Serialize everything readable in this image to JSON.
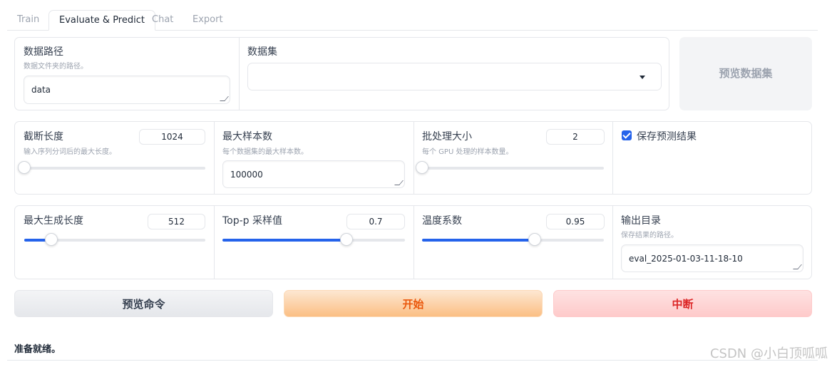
{
  "tabs": [
    {
      "label": "Train",
      "active": false
    },
    {
      "label": "Evaluate & Predict",
      "active": true
    },
    {
      "label": "Chat",
      "active": false
    },
    {
      "label": "Export",
      "active": false
    }
  ],
  "dataset_row": {
    "data_path": {
      "label": "数据路径",
      "info": "数据文件夹的路径。",
      "value": "data"
    },
    "dataset": {
      "label": "数据集",
      "value": ""
    },
    "preview_dataset_button": "预览数据集"
  },
  "row2": {
    "cutoff_len": {
      "label": "截断长度",
      "info": "输入序列分词后的最大长度。",
      "value": "1024",
      "level": 0.0
    },
    "max_samples": {
      "label": "最大样本数",
      "info": "每个数据集的最大样本数。",
      "value": "100000"
    },
    "batch_size": {
      "label": "批处理大小",
      "info": "每个 GPU 处理的样本数量。",
      "value": "2",
      "level": 0.0
    },
    "predict": {
      "label": "保存预测结果",
      "checked": true
    }
  },
  "row3": {
    "max_new_tokens": {
      "label": "最大生成长度",
      "value": "512",
      "level": 0.15
    },
    "top_p": {
      "label": "Top-p 采样值",
      "value": "0.7",
      "level": 0.68
    },
    "temperature": {
      "label": "温度系数",
      "value": "0.95",
      "level": 0.62
    },
    "output_dir": {
      "label": "输出目录",
      "info": "保存结果的路径。",
      "value": "eval_2025-01-03-11-18-10"
    }
  },
  "buttons": {
    "preview_command": "预览命令",
    "start": "开始",
    "abort": "中断"
  },
  "status": "准备就绪。",
  "watermark": "CSDN @小白顶呱呱",
  "colors": {
    "accent": "#2563eb",
    "start": "#ea580c",
    "abort": "#dc2626"
  }
}
